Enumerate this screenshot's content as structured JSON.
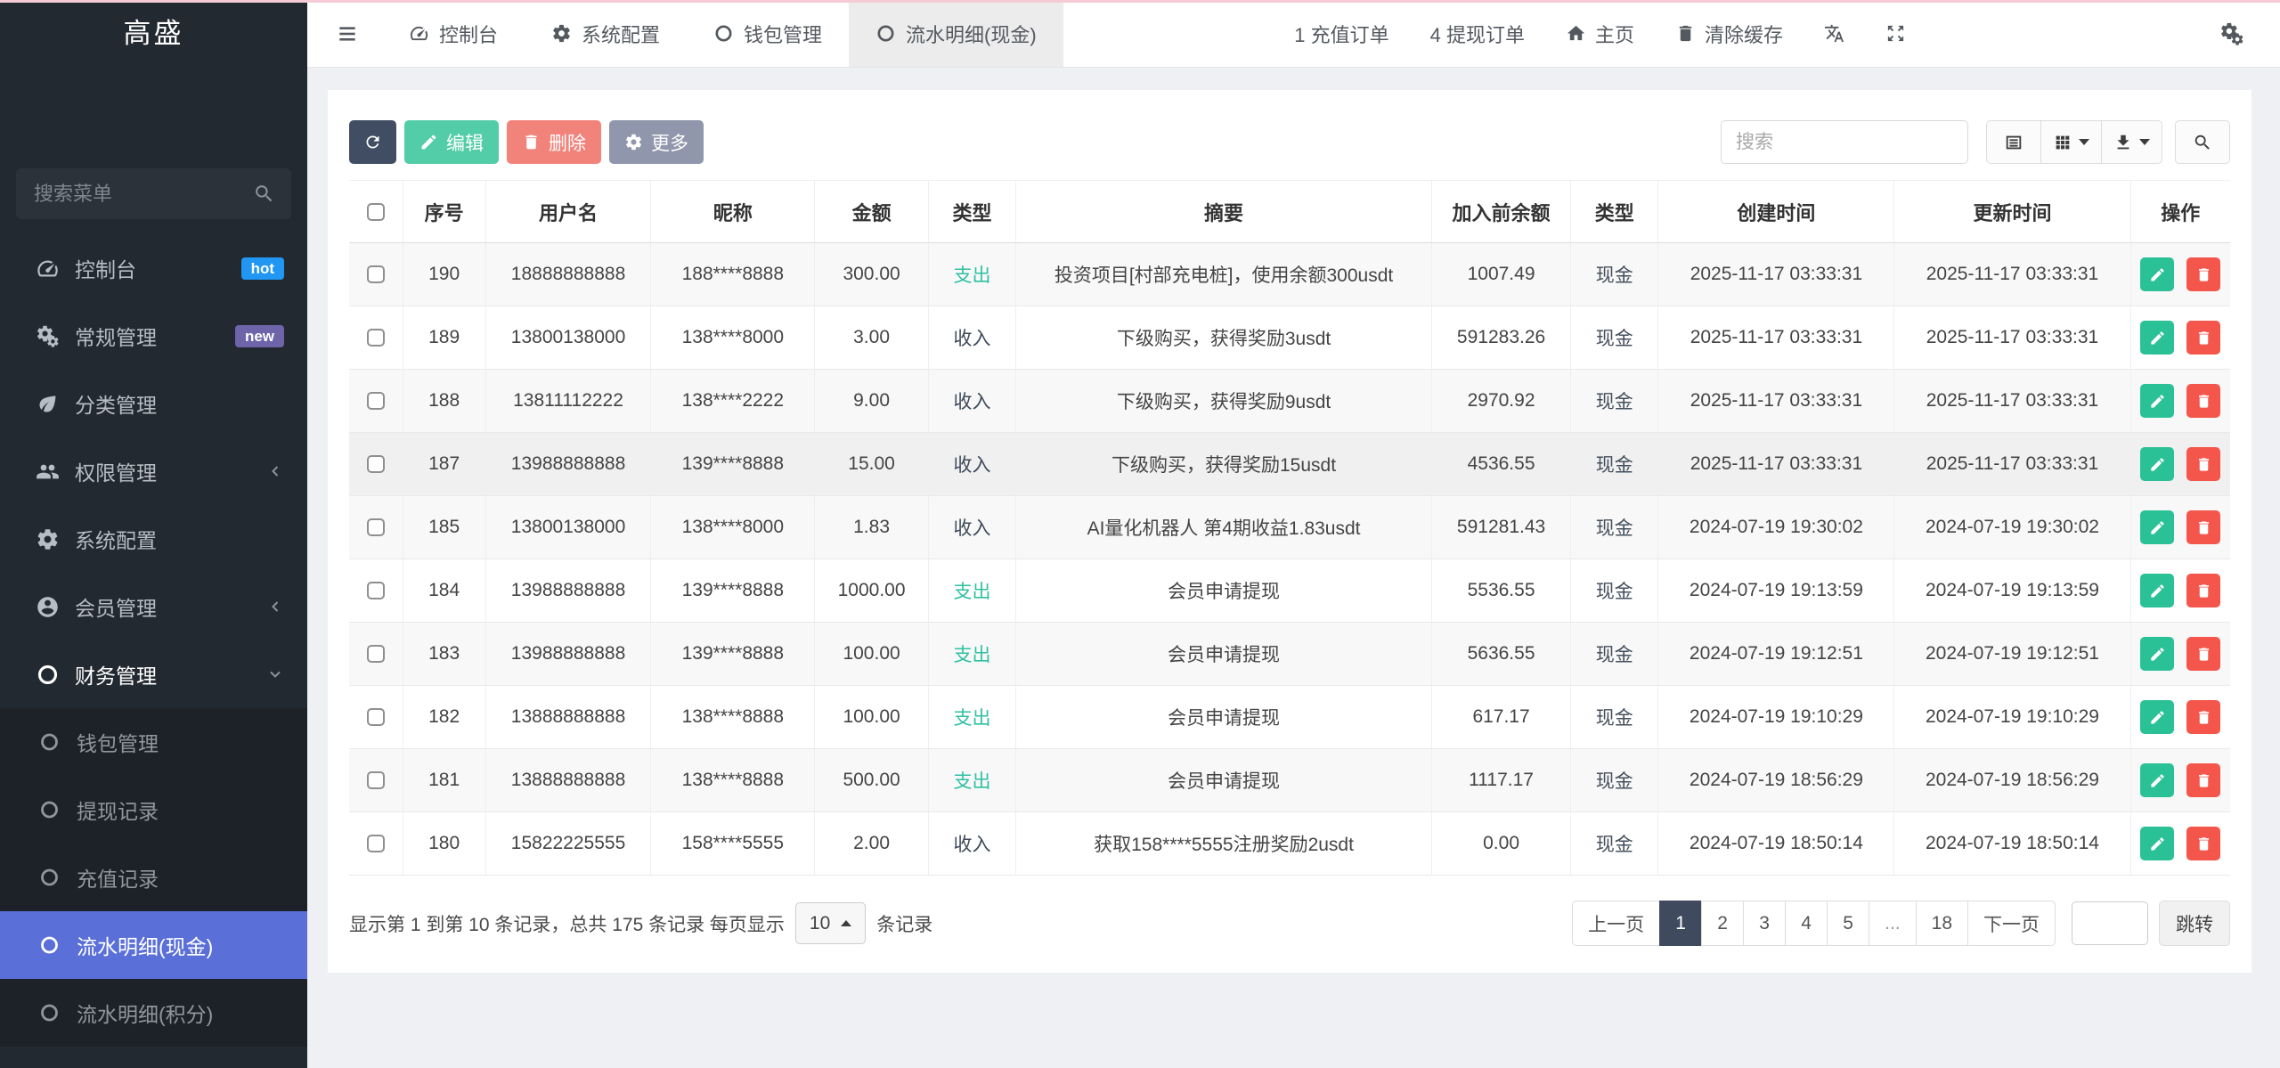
{
  "app": {
    "logo": "高盛"
  },
  "sidebar": {
    "search_placeholder": "搜索菜单",
    "items": [
      {
        "label": "控制台",
        "badge": "hot"
      },
      {
        "label": "常规管理",
        "badge": "new"
      },
      {
        "label": "分类管理"
      },
      {
        "label": "权限管理",
        "chevron": "left"
      },
      {
        "label": "系统配置"
      },
      {
        "label": "会员管理",
        "chevron": "left"
      },
      {
        "label": "财务管理",
        "chevron": "down"
      }
    ],
    "finance_children": [
      {
        "label": "钱包管理"
      },
      {
        "label": "提现记录"
      },
      {
        "label": "充值记录"
      },
      {
        "label": "流水明细(现金)",
        "active": true
      },
      {
        "label": "流水明细(积分)"
      }
    ],
    "active_child": "流水明细(现金)"
  },
  "topbar": {
    "tabs": [
      {
        "label": "控制台"
      },
      {
        "label": "系统配置"
      },
      {
        "label": "钱包管理"
      },
      {
        "label": "流水明细(现金)",
        "active": true
      }
    ],
    "recharge_orders": "1 充值订单",
    "withdraw_orders": "4 提现订单",
    "home": "主页",
    "clear_cache": "清除缓存"
  },
  "toolbar": {
    "edit_label": "编辑",
    "delete_label": "删除",
    "more_label": "更多",
    "search_placeholder": "搜索"
  },
  "table": {
    "columns": [
      "序号",
      "用户名",
      "昵称",
      "金额",
      "类型",
      "摘要",
      "加入前余额",
      "类型",
      "创建时间",
      "更新时间",
      "操作"
    ],
    "rows": [
      {
        "seq": "190",
        "username": "18888888888",
        "nickname": "188****8888",
        "amount": "300.00",
        "flow": "支出",
        "summary": "投资项目[村部充电桩]，使用余额300usdt",
        "balance": "1007.49",
        "type": "现金",
        "created": "2025-11-17 03:33:31",
        "updated": "2025-11-17 03:33:31"
      },
      {
        "seq": "189",
        "username": "13800138000",
        "nickname": "138****8000",
        "amount": "3.00",
        "flow": "收入",
        "summary": "下级购买，获得奖励3usdt",
        "balance": "591283.26",
        "type": "现金",
        "created": "2025-11-17 03:33:31",
        "updated": "2025-11-17 03:33:31"
      },
      {
        "seq": "188",
        "username": "13811112222",
        "nickname": "138****2222",
        "amount": "9.00",
        "flow": "收入",
        "summary": "下级购买，获得奖励9usdt",
        "balance": "2970.92",
        "type": "现金",
        "created": "2025-11-17 03:33:31",
        "updated": "2025-11-17 03:33:31"
      },
      {
        "seq": "187",
        "username": "13988888888",
        "nickname": "139****8888",
        "amount": "15.00",
        "flow": "收入",
        "summary": "下级购买，获得奖励15usdt",
        "balance": "4536.55",
        "type": "现金",
        "created": "2025-11-17 03:33:31",
        "updated": "2025-11-17 03:33:31"
      },
      {
        "seq": "185",
        "username": "13800138000",
        "nickname": "138****8000",
        "amount": "1.83",
        "flow": "收入",
        "summary": "AI量化机器人 第4期收益1.83usdt",
        "balance": "591281.43",
        "type": "现金",
        "created": "2024-07-19 19:30:02",
        "updated": "2024-07-19 19:30:02"
      },
      {
        "seq": "184",
        "username": "13988888888",
        "nickname": "139****8888",
        "amount": "1000.00",
        "flow": "支出",
        "summary": "会员申请提现",
        "balance": "5536.55",
        "type": "现金",
        "created": "2024-07-19 19:13:59",
        "updated": "2024-07-19 19:13:59"
      },
      {
        "seq": "183",
        "username": "13988888888",
        "nickname": "139****8888",
        "amount": "100.00",
        "flow": "支出",
        "summary": "会员申请提现",
        "balance": "5636.55",
        "type": "现金",
        "created": "2024-07-19 19:12:51",
        "updated": "2024-07-19 19:12:51"
      },
      {
        "seq": "182",
        "username": "13888888888",
        "nickname": "138****8888",
        "amount": "100.00",
        "flow": "支出",
        "summary": "会员申请提现",
        "balance": "617.17",
        "type": "现金",
        "created": "2024-07-19 19:10:29",
        "updated": "2024-07-19 19:10:29"
      },
      {
        "seq": "181",
        "username": "13888888888",
        "nickname": "138****8888",
        "amount": "500.00",
        "flow": "支出",
        "summary": "会员申请提现",
        "balance": "1117.17",
        "type": "现金",
        "created": "2024-07-19 18:56:29",
        "updated": "2024-07-19 18:56:29"
      },
      {
        "seq": "180",
        "username": "15822225555",
        "nickname": "158****5555",
        "amount": "2.00",
        "flow": "收入",
        "summary": "获取158****5555注册奖励2usdt",
        "balance": "0.00",
        "type": "现金",
        "created": "2024-07-19 18:50:14",
        "updated": "2024-07-19 18:50:14"
      }
    ]
  },
  "pagination": {
    "info_prefix": "显示第 1 到第 10 条记录，总共 175 条记录 每页显示",
    "page_size": "10",
    "info_suffix": "条记录",
    "pages": [
      "上一页",
      "1",
      "2",
      "3",
      "4",
      "5",
      "...",
      "18",
      "下一页"
    ],
    "active_page": "1",
    "jump_label": "跳转"
  },
  "colors": {
    "sidebar_bg": "#232930",
    "submenu_bg": "#1c2227",
    "active_menu": "#5a6fd8",
    "hot_badge": "#2196f3",
    "new_badge": "#6e64a9",
    "refresh_btn": "#414d62",
    "edit_btn": "#53cda7",
    "delete_btn": "#f2837b",
    "more_btn": "#9096ab",
    "row_edit_btn": "#2bc196",
    "row_delete_btn": "#f4564c",
    "flow_out": "#2fc0a2",
    "flow_in": "#3e4a5a",
    "pagination_active": "#3f4a5f"
  }
}
